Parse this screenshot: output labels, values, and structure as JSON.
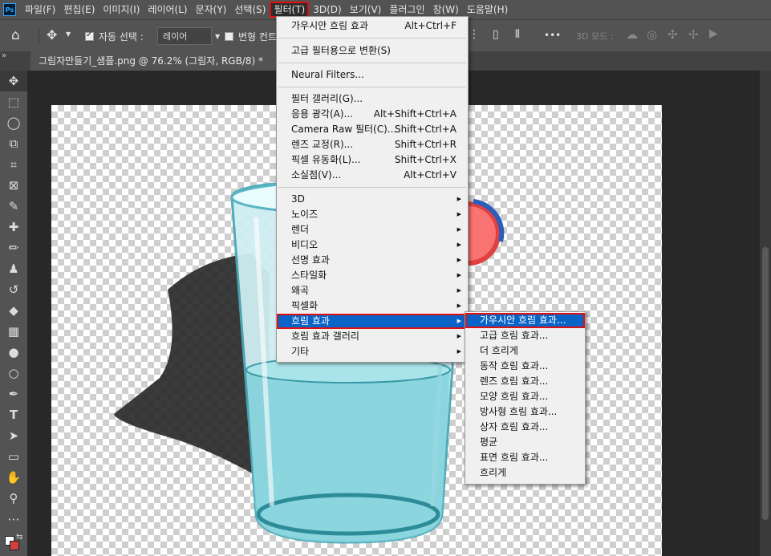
{
  "menubar": {
    "logo": "Ps",
    "items": [
      "파일(F)",
      "편집(E)",
      "이미지(I)",
      "레이어(L)",
      "문자(Y)",
      "선택(S)",
      "필터(T)",
      "3D(D)",
      "보기(V)",
      "플러그인",
      "창(W)",
      "도움말(H)"
    ]
  },
  "options": {
    "auto_select_label": "자동 선택 :",
    "layer_select": "레이어",
    "transform_label": "변형 컨트",
    "more": "•••",
    "mode3d_label": "3D 모드 :"
  },
  "document": {
    "tab_title": "그림자만들기_샘플.png @ 76.2% (그림자, RGB/8) *",
    "tab_close": "×"
  },
  "filter_menu": {
    "items": [
      {
        "label": "가우시안 흐림 효과",
        "shortcut": "Alt+Ctrl+F"
      },
      {
        "label": "고급 필터용으로 변환(S)",
        "shortcut": ""
      },
      {
        "label": "Neural Filters...",
        "shortcut": ""
      },
      {
        "label": "필터 갤러리(G)...",
        "shortcut": ""
      },
      {
        "label": "응용 광각(A)...",
        "shortcut": "Alt+Shift+Ctrl+A"
      },
      {
        "label": "Camera Raw 필터(C)...",
        "shortcut": "Shift+Ctrl+A"
      },
      {
        "label": "렌즈 교정(R)...",
        "shortcut": "Shift+Ctrl+R"
      },
      {
        "label": "픽셀 유동화(L)...",
        "shortcut": "Shift+Ctrl+X"
      },
      {
        "label": "소실점(V)...",
        "shortcut": "Alt+Ctrl+V"
      },
      {
        "label": "3D",
        "shortcut": ""
      },
      {
        "label": "노이즈",
        "shortcut": ""
      },
      {
        "label": "렌더",
        "shortcut": ""
      },
      {
        "label": "비디오",
        "shortcut": ""
      },
      {
        "label": "선명 효과",
        "shortcut": ""
      },
      {
        "label": "스타일화",
        "shortcut": ""
      },
      {
        "label": "왜곡",
        "shortcut": ""
      },
      {
        "label": "픽셀화",
        "shortcut": ""
      },
      {
        "label": "흐림 효과",
        "shortcut": ""
      },
      {
        "label": "흐림 효과 갤러리",
        "shortcut": ""
      },
      {
        "label": "기타",
        "shortcut": ""
      }
    ]
  },
  "blur_submenu": {
    "items": [
      "가우시안 흐림 효과...",
      "고급 흐림 효과...",
      "더 흐리게",
      "동작 흐림 효과...",
      "렌즈 흐림 효과...",
      "모양 흐림 효과...",
      "방사형 흐림 효과...",
      "상자 흐림 효과...",
      "평균",
      "표면 흐림 효과...",
      "흐리게"
    ]
  },
  "colors": {
    "highlight": "#0a64c8",
    "outline": "#e01010",
    "ui_gray": "#535353"
  }
}
